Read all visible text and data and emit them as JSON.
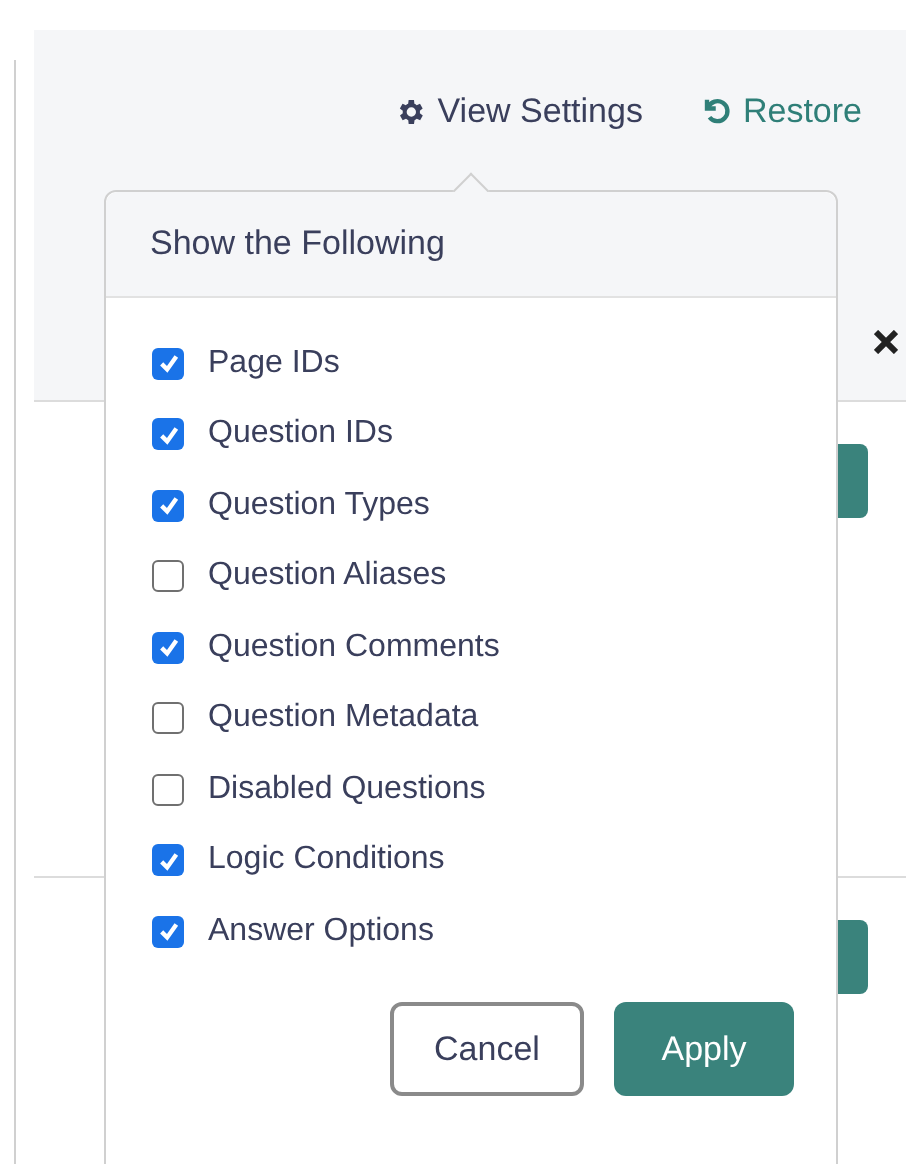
{
  "toolbar": {
    "view_settings": "View Settings",
    "restore": "Restore"
  },
  "popover": {
    "title": "Show the Following",
    "options": [
      {
        "label": "Page IDs",
        "checked": true
      },
      {
        "label": "Question IDs",
        "checked": true
      },
      {
        "label": "Question Types",
        "checked": true
      },
      {
        "label": "Question Aliases",
        "checked": false
      },
      {
        "label": "Question Comments",
        "checked": true
      },
      {
        "label": "Question Metadata",
        "checked": false
      },
      {
        "label": "Disabled Questions",
        "checked": false
      },
      {
        "label": "Logic Conditions",
        "checked": true
      },
      {
        "label": "Answer Options",
        "checked": true
      }
    ],
    "buttons": [
      {
        "label": "Cancel",
        "kind": "secondary"
      },
      {
        "label": "Apply",
        "kind": "primary"
      }
    ]
  }
}
